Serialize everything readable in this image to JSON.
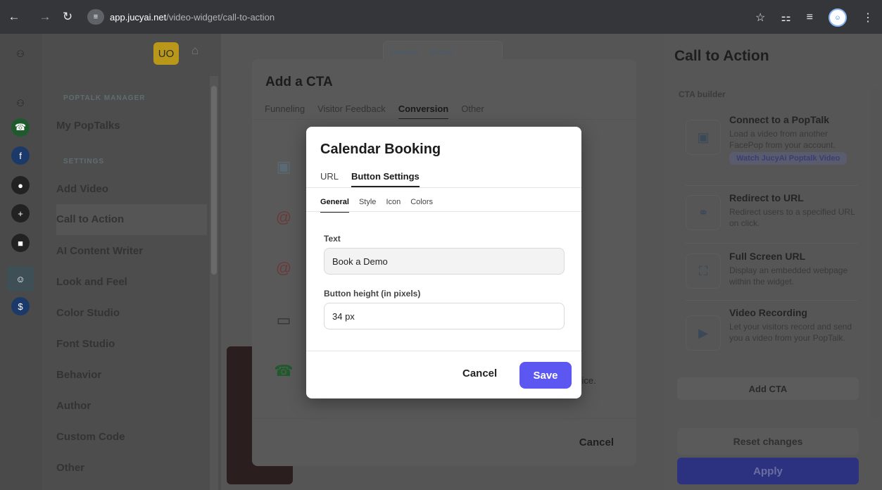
{
  "browser": {
    "host": "app.jucyai.net",
    "path": "/video-widget/call-to-action"
  },
  "sidebar": {
    "user_initials": "UO",
    "sections": {
      "manager": "POPTALK MANAGER",
      "settings": "SETTINGS"
    },
    "items": [
      {
        "label": "My PopTalks"
      },
      {
        "label": "Add Video"
      },
      {
        "label": "Call to Action"
      },
      {
        "label": "AI Content Writer"
      },
      {
        "label": "Look and Feel"
      },
      {
        "label": "Color Studio"
      },
      {
        "label": "Font Studio"
      },
      {
        "label": "Behavior"
      },
      {
        "label": "Author"
      },
      {
        "label": "Custom Code"
      },
      {
        "label": "Other"
      }
    ],
    "active_item": "Call to Action"
  },
  "iconbar": {
    "icons": [
      "logo-icon",
      "whatsapp-icon",
      "facebook-icon",
      "chat-icon",
      "plus-icon",
      "message-icon",
      "widget-icon",
      "dollar-icon"
    ]
  },
  "preview": {
    "device_toggle": [
      "Desktop",
      "Mobile"
    ]
  },
  "right_panel": {
    "title": "Call to Action",
    "subtitle": "CTA builder",
    "cards": [
      {
        "title": "Connect to a PopTalk",
        "description": "Load a video from another FacePop from your account.",
        "badge": "Watch JucyAi Poptalk Video",
        "icon": "image-placeholder-icon"
      },
      {
        "title": "Redirect to URL",
        "description": "Redirect users to a specified URL on click.",
        "icon": "link-icon"
      },
      {
        "title": "Full Screen URL",
        "description": "Display an embedded webpage within the widget.",
        "icon": "fullscreen-icon"
      },
      {
        "title": "Video Recording",
        "description": "Let your visitors record and send you a video from your PopTalk.",
        "icon": "video-recording-icon"
      }
    ],
    "add_cta": "Add CTA",
    "reset": "Reset changes",
    "apply": "Apply"
  },
  "modal_cta": {
    "title": "Add a CTA",
    "tabs": [
      "Funneling",
      "Visitor Feedback",
      "Conversion",
      "Other"
    ],
    "active_tab": "Conversion",
    "visible_text_fragment": "vice.",
    "cancel": "Cancel"
  },
  "modal_booking": {
    "title": "Calendar Booking",
    "tabs": [
      "URL",
      "Button Settings"
    ],
    "active_tab": "Button Settings",
    "subtabs": [
      "General",
      "Style",
      "Icon",
      "Colors"
    ],
    "active_subtab": "General",
    "fields": {
      "text_label": "Text",
      "text_value": "Book a Demo",
      "height_label": "Button height (in pixels)",
      "height_value": "34 px"
    },
    "cancel": "Cancel",
    "save": "Save"
  },
  "colors": {
    "accent": "#5b57f0",
    "apply": "#2d3280",
    "highlight": "#b99718"
  }
}
